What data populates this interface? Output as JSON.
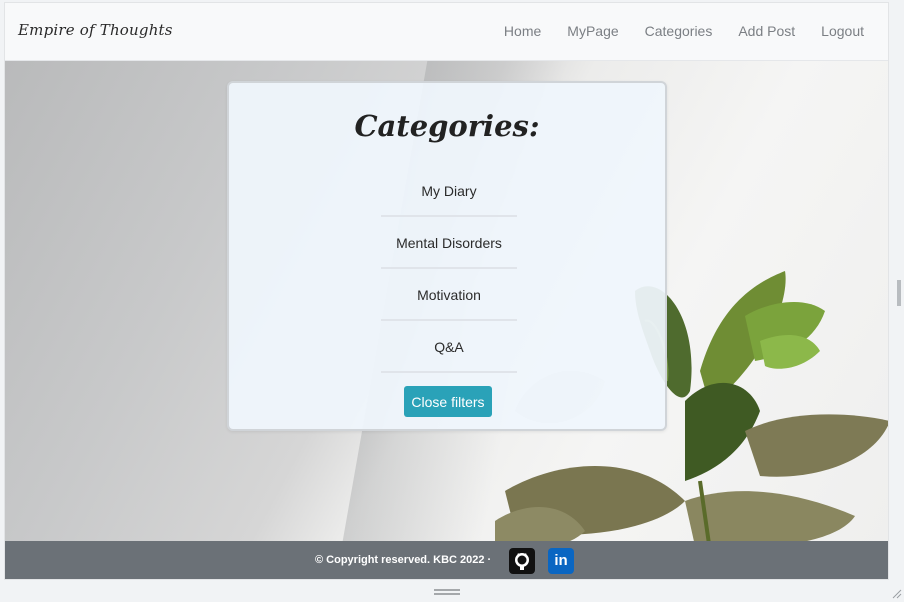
{
  "brand": "Empire of Thoughts",
  "nav": [
    "Home",
    "MyPage",
    "Categories",
    "Add Post",
    "Logout"
  ],
  "panel": {
    "title": "Categories:",
    "categories": [
      "My Diary",
      "Mental Disorders",
      "Motivation",
      "Q&A"
    ],
    "close_button": "Close filters"
  },
  "footer": {
    "copyright": "© Copyright reserved. KBC 2022 ·",
    "icons": [
      "github-icon",
      "linkedin-icon"
    ],
    "linkedin_glyph": "in"
  },
  "colors": {
    "accent": "#2aa2b8",
    "footer_bg": "#6b7177",
    "navbar_bg": "#f8f9fa",
    "linkedin": "#0a66c2"
  }
}
